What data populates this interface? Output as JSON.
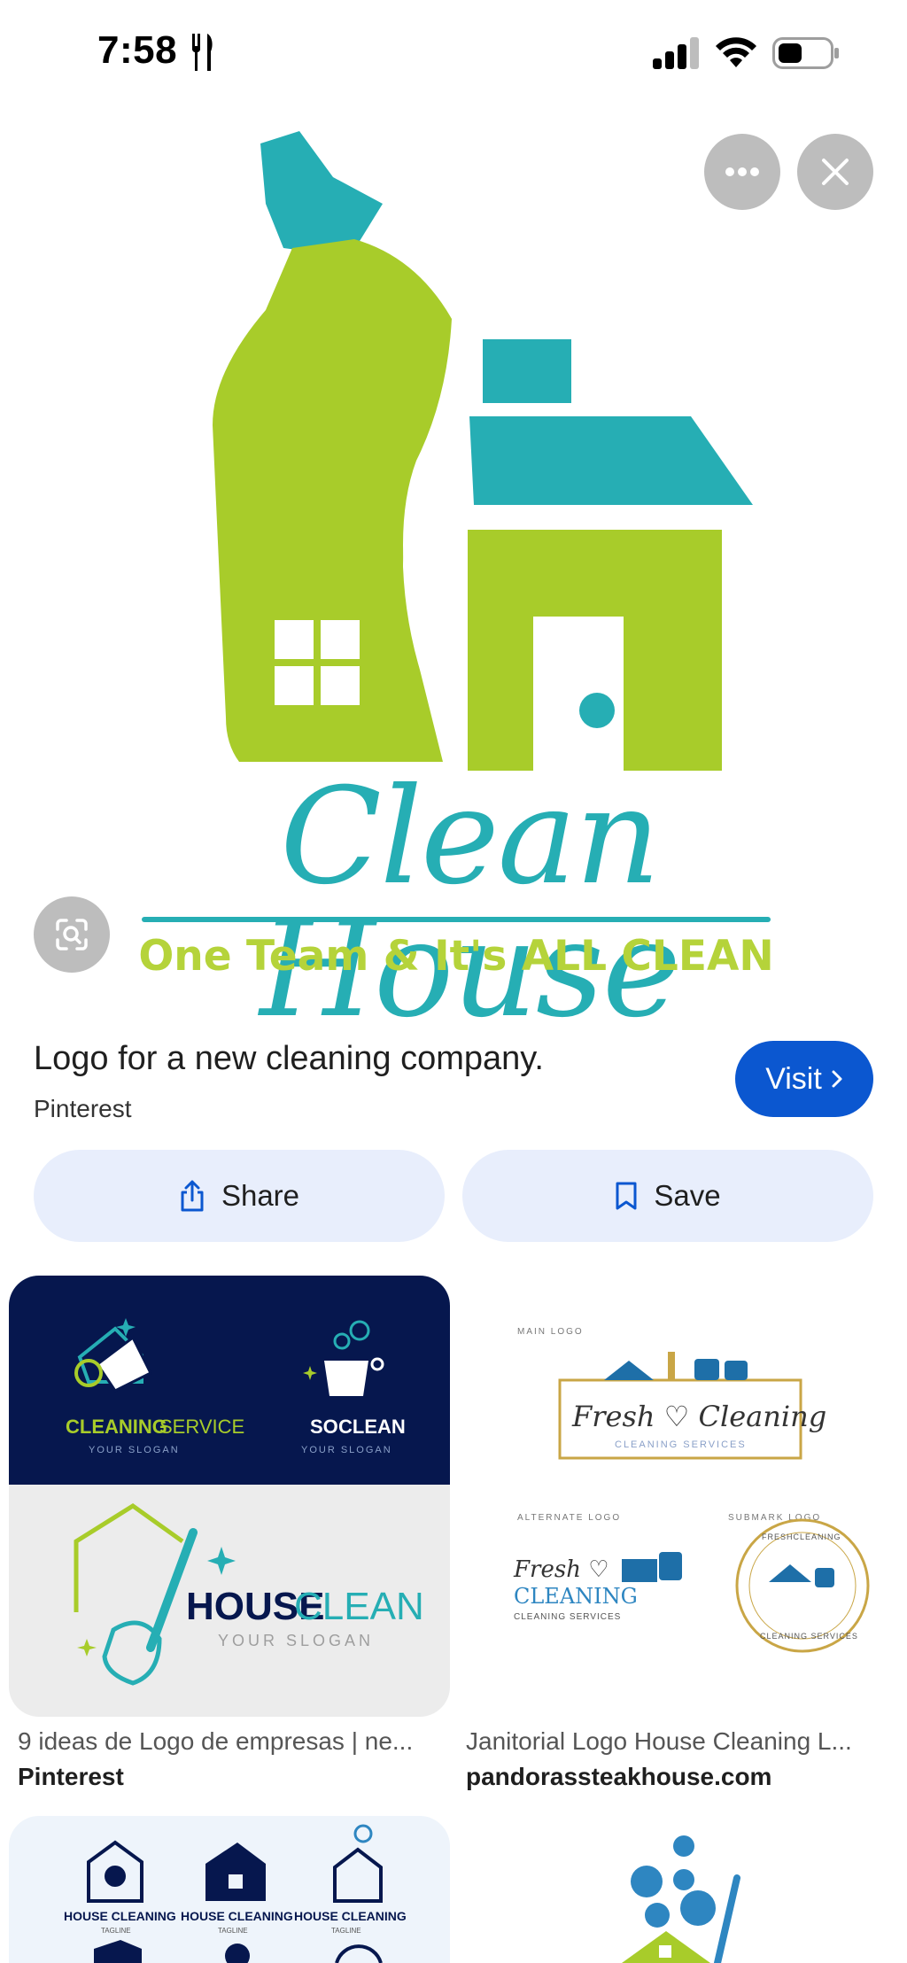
{
  "status": {
    "time": "7:58",
    "icons": [
      "fork-knife-icon",
      "cellular-signal-icon",
      "wifi-icon",
      "battery-icon"
    ]
  },
  "hero": {
    "logo_title": "Clean House",
    "logo_tagline": "One Team & It's ALL CLEAN",
    "more_icon": "more-horizontal-icon",
    "close_icon": "close-icon",
    "lens_icon": "lens-search-icon"
  },
  "result": {
    "title": "Logo for a new cleaning company.",
    "source": "Pinterest",
    "visit_label": "Visit"
  },
  "actions": {
    "share_label": "Share",
    "save_label": "Save"
  },
  "related": [
    {
      "title": "9 ideas de Logo de empresas | ne...",
      "source": "Pinterest",
      "logo_texts": {
        "a_main": "CLEANING",
        "a_suffix": "SERVICE",
        "a_sub": "YOUR SLOGAN",
        "b_main": "SO",
        "b_suffix": "CLEAN",
        "b_sub": "YOUR SLOGAN",
        "c_main": "HOUSE",
        "c_suffix": "CLEAN",
        "c_sub": "YOUR SLOGAN"
      }
    },
    {
      "title": "Janitorial Logo House Cleaning L...",
      "source": "pandorassteakhouse.com",
      "logo_texts": {
        "main_label": "MAIN LOGO",
        "main_name": "Fresh ♡ Cleaning",
        "main_sub": "CLEANING SERVICES",
        "alt_label": "ALTERNATE LOGO",
        "alt_name1": "Fresh ♡",
        "alt_name2": "CLEANING",
        "alt_sub": "CLEANING SERVICES",
        "sub_label": "SUBMARK LOGO",
        "sub_ring1": "FRESHCLEANING",
        "sub_ring2": "CLEANING SERVICES"
      }
    }
  ],
  "related_partial": {
    "card3_labels": [
      "HOUSE CLEANING",
      "HOUSE CLEANING",
      "HOUSE CLEANING"
    ],
    "card3_tag": "TAGLINE"
  },
  "colors": {
    "logo_green": "#a8cc2a",
    "logo_teal": "#26aeb4",
    "visit_blue": "#0b57d0",
    "pill_bg": "#e8eefc",
    "navy": "#06174e"
  }
}
